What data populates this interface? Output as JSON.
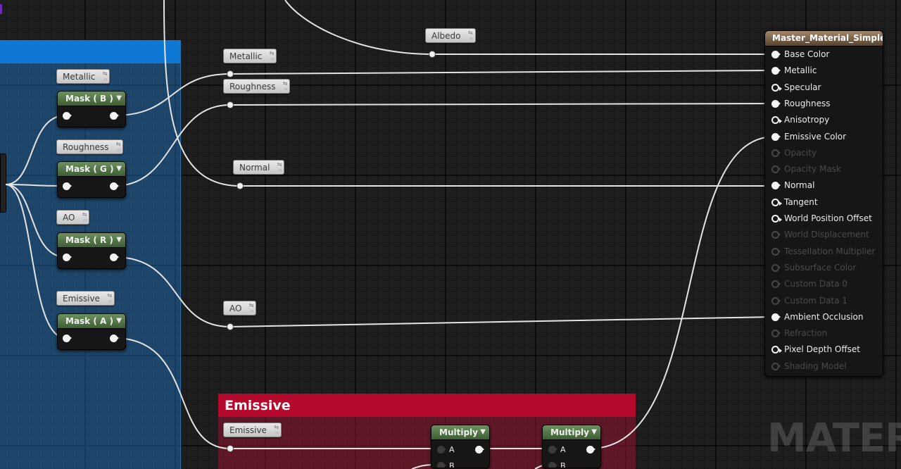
{
  "comments": {
    "emissive_title": "Emissive"
  },
  "parameters": [
    {
      "id": "albedo",
      "label": "Albedo"
    },
    {
      "id": "metallic_out",
      "label": "Metallic"
    },
    {
      "id": "roughness_out",
      "label": "Roughness"
    },
    {
      "id": "normal_out",
      "label": "Normal"
    },
    {
      "id": "ao_out",
      "label": "AO"
    },
    {
      "id": "metallic_in",
      "label": "Metallic"
    },
    {
      "id": "roughness_in",
      "label": "Roughness"
    },
    {
      "id": "ao_in",
      "label": "AO"
    },
    {
      "id": "emissive_in",
      "label": "Emissive"
    },
    {
      "id": "emissive_out",
      "label": "Emissive"
    }
  ],
  "mask_nodes": [
    {
      "id": "mask_b",
      "title": "Mask ( B )"
    },
    {
      "id": "mask_g",
      "title": "Mask ( G )"
    },
    {
      "id": "mask_r",
      "title": "Mask ( R )"
    },
    {
      "id": "mask_a",
      "title": "Mask ( A )"
    }
  ],
  "multiply_nodes": [
    {
      "id": "multiply_1",
      "title": "Multiply",
      "pin_a": "A",
      "pin_b": "B"
    },
    {
      "id": "multiply_2",
      "title": "Multiply",
      "pin_a": "A",
      "pin_b": "B"
    }
  ],
  "master_node": {
    "title": "Master_Material_Simple",
    "pins": [
      {
        "label": "Base Color",
        "state": "connected"
      },
      {
        "label": "Metallic",
        "state": "connected"
      },
      {
        "label": "Specular",
        "state": "open"
      },
      {
        "label": "Roughness",
        "state": "connected"
      },
      {
        "label": "Anisotropy",
        "state": "open"
      },
      {
        "label": "Emissive Color",
        "state": "connected"
      },
      {
        "label": "Opacity",
        "state": "disabled"
      },
      {
        "label": "Opacity Mask",
        "state": "disabled"
      },
      {
        "label": "Normal",
        "state": "connected"
      },
      {
        "label": "Tangent",
        "state": "open"
      },
      {
        "label": "World Position Offset",
        "state": "open"
      },
      {
        "label": "World Displacement",
        "state": "disabled"
      },
      {
        "label": "Tessellation Multiplier",
        "state": "disabled"
      },
      {
        "label": "Subsurface Color",
        "state": "disabled"
      },
      {
        "label": "Custom Data 0",
        "state": "disabled"
      },
      {
        "label": "Custom Data 1",
        "state": "disabled"
      },
      {
        "label": "Ambient Occlusion",
        "state": "connected"
      },
      {
        "label": "Refraction",
        "state": "disabled"
      },
      {
        "label": "Pixel Depth Offset",
        "state": "open"
      },
      {
        "label": "Shading Model",
        "state": "disabled"
      }
    ]
  },
  "watermark": "MATERIA",
  "colors": {
    "comment_blue": "#0e78d4",
    "comment_red": "#b4082c",
    "node_header_green": "#4f7245",
    "master_header_brown": "#7d664f",
    "wire": "#e4e4e4"
  }
}
